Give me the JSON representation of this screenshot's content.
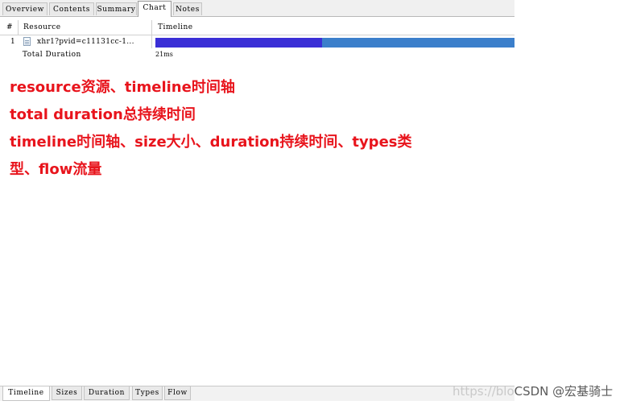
{
  "top_tabs": [
    {
      "label": "Overview",
      "active": false
    },
    {
      "label": "Contents",
      "active": false
    },
    {
      "label": "Summary",
      "active": false
    },
    {
      "label": "Chart",
      "active": true
    },
    {
      "label": "Notes",
      "active": false
    }
  ],
  "grid": {
    "headers": {
      "num": "#",
      "resource": "Resource",
      "timeline": "Timeline"
    },
    "rows": [
      {
        "num": "1",
        "icon": "document-icon",
        "resource": "xhr1?pvid=c11131cc-1...",
        "timeline_bar_colors": [
          "#3a2fd6",
          "#3b7fcb"
        ]
      }
    ],
    "total_label": "Total Duration",
    "total_value": "21ms"
  },
  "notes": [
    "resource资源、timeline时间轴",
    "total duration总持续时间",
    "timeline时间轴、size大小、duration持续时间、types类",
    "型、flow流量"
  ],
  "notes_color": "#e8141c",
  "bottom_tabs": [
    {
      "label": "Timeline",
      "active": true
    },
    {
      "label": "Sizes",
      "active": false
    },
    {
      "label": "Duration",
      "active": false
    },
    {
      "label": "Types",
      "active": false
    },
    {
      "label": "Flow",
      "active": false
    }
  ],
  "watermark": {
    "faded": "https://blo",
    "text": "CSDN @宏基骑士"
  }
}
